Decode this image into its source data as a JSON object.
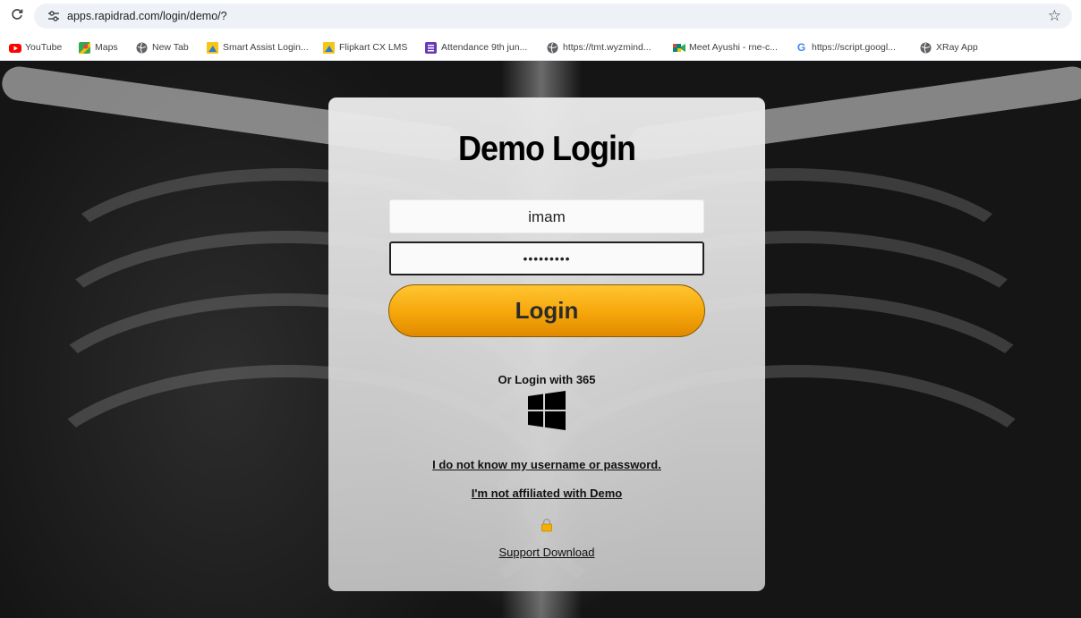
{
  "browser": {
    "url": "apps.rapidrad.com/login/demo/?",
    "bookmarks": [
      {
        "label": "YouTube",
        "icon": "youtube-icon",
        "color": "#ff0000"
      },
      {
        "label": "Maps",
        "icon": "maps-icon",
        "color": "#34a853"
      },
      {
        "label": "New Tab",
        "icon": "globe-icon",
        "color": "#5f6368"
      },
      {
        "label": "Smart Assist Login...",
        "icon": "smart-assist-icon",
        "color": "#f5c518"
      },
      {
        "label": "Flipkart CX LMS",
        "icon": "flipkart-icon",
        "color": "#f5c518"
      },
      {
        "label": "Attendance 9th jun...",
        "icon": "forms-icon",
        "color": "#673ab7"
      },
      {
        "label": "https://tmt.wyzmind...",
        "icon": "globe-icon",
        "color": "#5f6368"
      },
      {
        "label": "Meet Ayushi - rne-c...",
        "icon": "meet-icon",
        "color": "#00897b"
      },
      {
        "label": "https://script.googl...",
        "icon": "google-icon",
        "color": "#4285f4"
      },
      {
        "label": "XRay App",
        "icon": "globe-icon",
        "color": "#5f6368"
      }
    ]
  },
  "login": {
    "title": "Demo Login",
    "username_value": "imam",
    "password_mask": "•••••••••",
    "login_label": "Login",
    "or_365_label": "Or Login with 365",
    "forgot_link": "I do not know my username or password.",
    "not_affiliated_link": "I'm not affiliated with Demo",
    "support_link": "Support Download"
  },
  "colors": {
    "login_button": "#f5a60a",
    "card_bg": "#e2e2e2"
  }
}
